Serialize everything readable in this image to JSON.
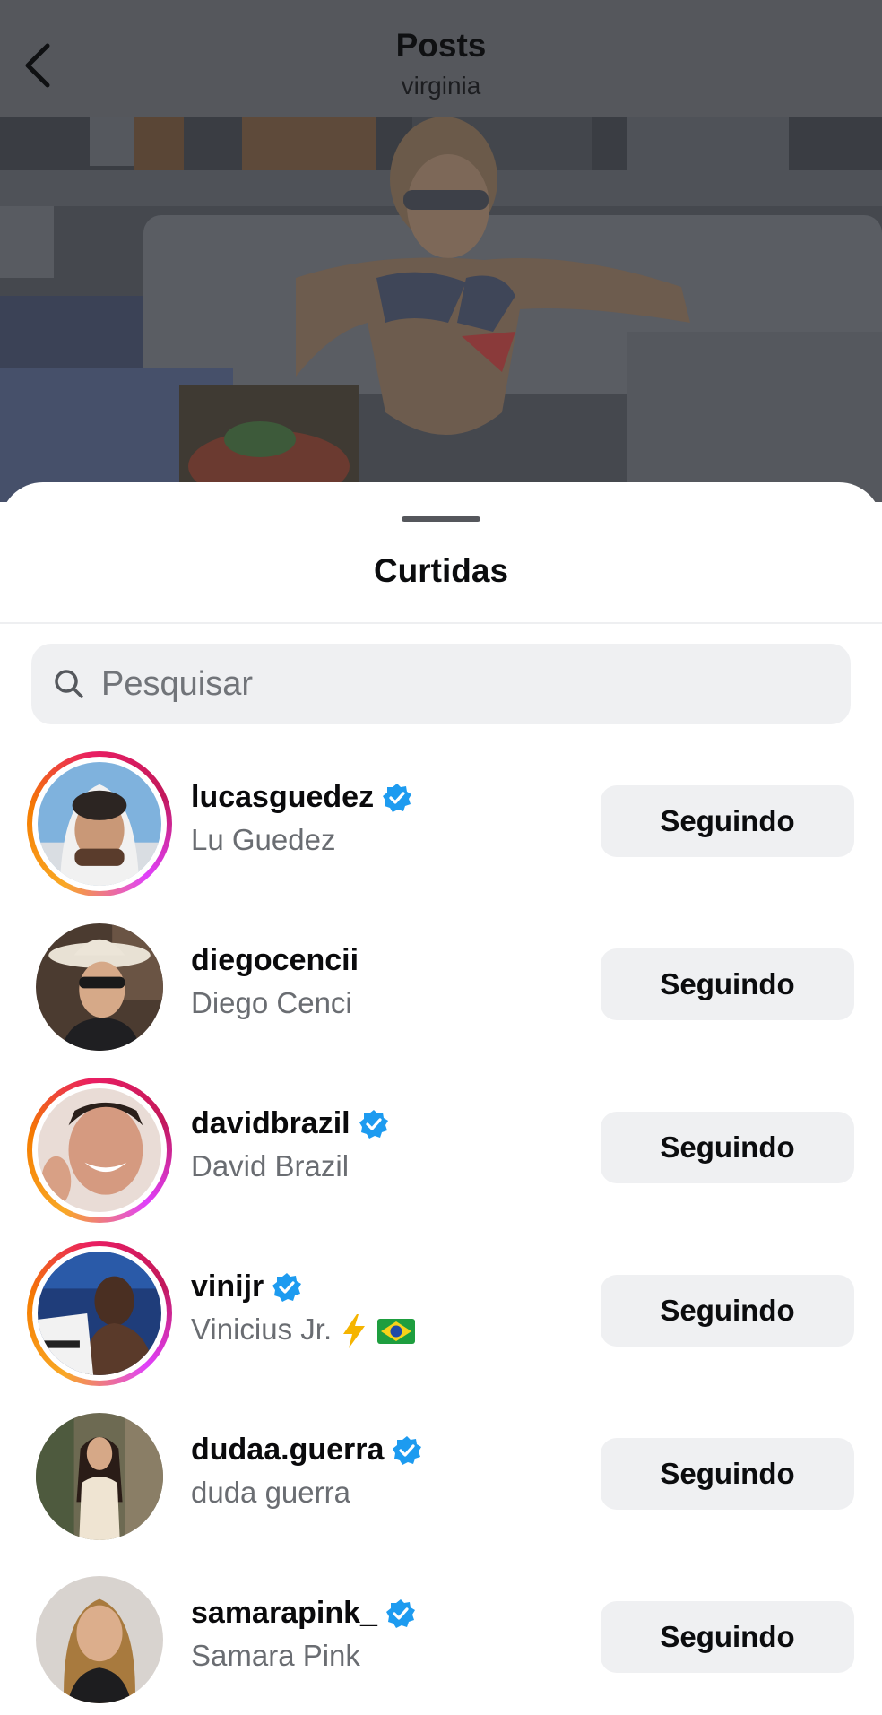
{
  "header": {
    "title": "Posts",
    "subtitle": "virginia",
    "back_icon": "chevron-left-icon"
  },
  "sheet": {
    "title": "Curtidas",
    "search": {
      "placeholder": "Pesquisar",
      "value": ""
    }
  },
  "likes": [
    {
      "username": "lucasguedez",
      "full_name": "Lu Guedez",
      "verified": true,
      "story_ring": true,
      "button": "Seguindo"
    },
    {
      "username": "diegocencii",
      "full_name": "Diego Cenci",
      "verified": false,
      "story_ring": false,
      "button": "Seguindo"
    },
    {
      "username": "davidbrazil",
      "full_name": "David Brazil",
      "verified": true,
      "story_ring": true,
      "button": "Seguindo"
    },
    {
      "username": "vinijr",
      "full_name": "Vinicius Jr.",
      "verified": true,
      "story_ring": true,
      "button": "Seguindo",
      "name_emojis": [
        "lightning-emoji",
        "brazil-flag-emoji"
      ]
    },
    {
      "username": "dudaa.guerra",
      "full_name": "duda guerra",
      "verified": true,
      "story_ring": false,
      "button": "Seguindo"
    },
    {
      "username": "samarapink_",
      "full_name": "Samara Pink",
      "verified": true,
      "story_ring": false,
      "button": "Seguindo"
    }
  ],
  "colors": {
    "verified_blue": "#1d9bf0",
    "button_bg": "#eff0f2",
    "secondary_text": "#6a6d72",
    "dim_overlay": "#4a4c51"
  }
}
